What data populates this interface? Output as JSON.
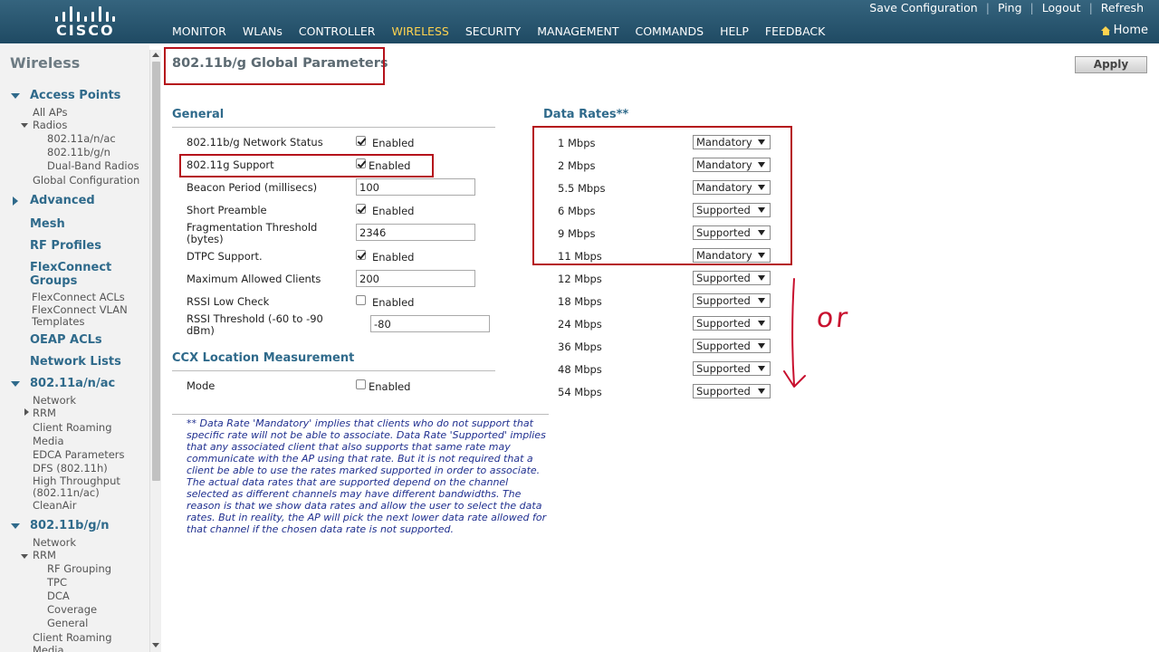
{
  "brand": {
    "logo_text": "CISCO"
  },
  "utility_links": [
    "Save Configuration",
    "Ping",
    "Logout",
    "Refresh"
  ],
  "main_nav": [
    {
      "label": "MONITOR"
    },
    {
      "label": "WLANs"
    },
    {
      "label": "CONTROLLER"
    },
    {
      "label": "WIRELESS",
      "active": true
    },
    {
      "label": "SECURITY"
    },
    {
      "label": "MANAGEMENT"
    },
    {
      "label": "COMMANDS"
    },
    {
      "label": "HELP"
    },
    {
      "label": "FEEDBACK"
    }
  ],
  "home_label": "Home",
  "sidebar": {
    "title": "Wireless",
    "items": [
      "Access Points",
      "All APs",
      "Radios",
      "802.11a/n/ac",
      "802.11b/g/n",
      "Dual-Band Radios",
      "Global Configuration",
      "Advanced",
      "Mesh",
      "RF Profiles",
      "FlexConnect",
      "Groups",
      "FlexConnect ACLs",
      "FlexConnect VLAN",
      "Templates",
      "OEAP ACLs",
      "Network Lists",
      "802.11a/n/ac",
      "Network",
      "RRM",
      "Client Roaming",
      "Media",
      "EDCA Parameters",
      "DFS (802.11h)",
      "High Throughput",
      "(802.11n/ac)",
      "CleanAir",
      "802.11b/g/n",
      "Network",
      "RRM",
      "RF Grouping",
      "TPC",
      "DCA",
      "Coverage",
      "General",
      "Client Roaming",
      "Media"
    ]
  },
  "page": {
    "title": "802.11b/g Global Parameters",
    "apply_label": "Apply",
    "general_title": "General",
    "ccx_title": "CCX Location Measurement",
    "data_rates_title": "Data Rates**",
    "enabled_label": "Enabled"
  },
  "general": {
    "network_status": {
      "label": "802.11b/g Network Status",
      "checked": true
    },
    "g_support": {
      "label": "802.11g Support",
      "checked": true
    },
    "beacon": {
      "label": "Beacon Period (millisecs)",
      "value": "100"
    },
    "short_preamble": {
      "label": "Short Preamble",
      "checked": true
    },
    "frag_label_1": "Fragmentation Threshold",
    "frag_label_2": "(bytes)",
    "frag_value": "2346",
    "dtpc": {
      "label": "DTPC Support.",
      "checked": true
    },
    "max_clients": {
      "label": "Maximum Allowed Clients",
      "value": "200"
    },
    "rssi_low": {
      "label": "RSSI Low Check",
      "checked": false
    },
    "rssi_thr_label_1": "RSSI Threshold (-60 to -90",
    "rssi_thr_label_2": "dBm)",
    "rssi_thr_value": "-80"
  },
  "ccx": {
    "mode_label": "Mode",
    "checked": false
  },
  "data_rates": [
    {
      "rate": "1 Mbps",
      "value": "Mandatory"
    },
    {
      "rate": "2 Mbps",
      "value": "Mandatory"
    },
    {
      "rate": "5.5 Mbps",
      "value": "Mandatory"
    },
    {
      "rate": "6 Mbps",
      "value": "Supported"
    },
    {
      "rate": "9 Mbps",
      "value": "Supported"
    },
    {
      "rate": "11 Mbps",
      "value": "Mandatory"
    },
    {
      "rate": "12 Mbps",
      "value": "Supported"
    },
    {
      "rate": "18 Mbps",
      "value": "Supported"
    },
    {
      "rate": "24 Mbps",
      "value": "Supported"
    },
    {
      "rate": "36 Mbps",
      "value": "Supported"
    },
    {
      "rate": "48 Mbps",
      "value": "Supported"
    },
    {
      "rate": "54 Mbps",
      "value": "Supported"
    }
  ],
  "note": "** Data Rate 'Mandatory' implies that clients who do not support that specific rate will not be able to associate. Data Rate 'Supported' implies that any associated client that also supports that same rate may communicate with the AP using that rate. But it is not required that a client be able to use the rates marked supported in order to associate. The actual data rates that are supported depend on the channel selected as different channels may have different bandwidths. The reason is that we show data rates and allow the user to select the data rates. But in reality, the AP will pick the next lower data rate allowed for that channel if the chosen data rate is not supported.",
  "annotation": {
    "handwritten_text": "or",
    "color": "#c8102e"
  },
  "colors": {
    "header": "#2b5a73",
    "accent": "#2f6a8b",
    "active_nav": "#ffd34f",
    "highlight": "#b5121b"
  }
}
